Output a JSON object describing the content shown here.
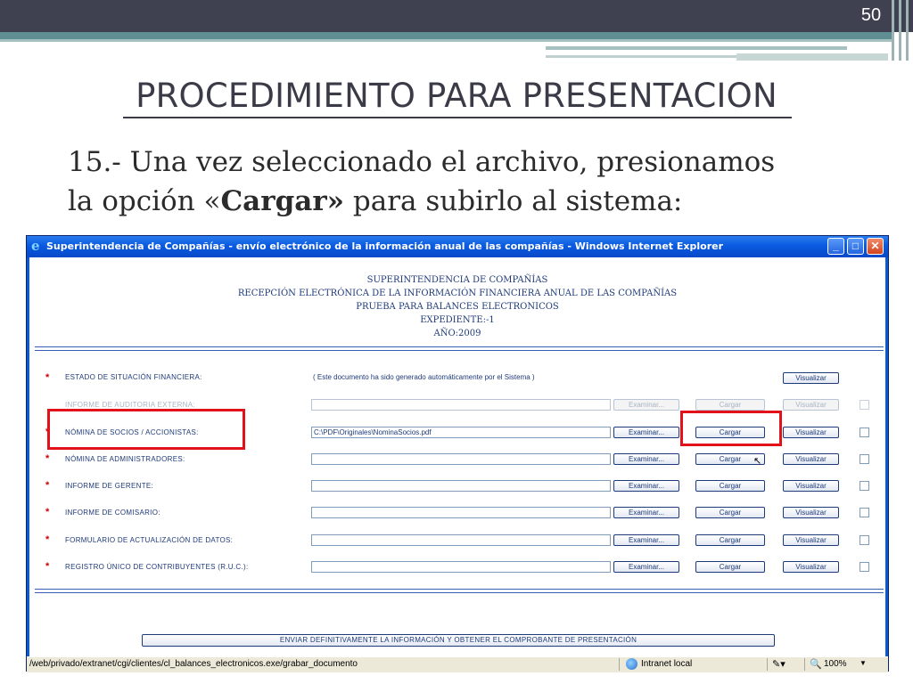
{
  "slide": {
    "page_number": "50",
    "title": "PROCEDIMIENTO PARA PRESENTACION",
    "body_line1": "15.- Una vez seleccionado el archivo, presionamos",
    "body_line2_pre": "la opción «",
    "body_line2_bold": "Cargar»",
    "body_line2_post": " para subirlo al sistema:"
  },
  "window": {
    "title": "Superintendencia de Compañías - envío electrónico de la información anual de las compañías - Windows Internet Explorer",
    "min_label": "_",
    "max_label": "□",
    "close_label": "✕"
  },
  "page_header": {
    "line1": "SUPERINTENDENCIA DE COMPAÑÍAS",
    "line2": "RECEPCIÓN ELECTRÓNICA DE LA INFORMACIÓN FINANCIERA ANUAL DE LAS COMPAÑÍAS",
    "line3": "PRUEBA PARA BALANCES ELECTRONICOS",
    "line4": "EXPEDIENTE:-1",
    "line5": "AÑO:2009"
  },
  "form": {
    "required_marker": "*",
    "rows": [
      {
        "label": "ESTADO DE SITUACIÓN FINANCIERA:",
        "note": "( Este documento ha sido generado automáticamente por el Sistema )",
        "visualizar": "Visualizar"
      },
      {
        "label": "INFORME DE AUDITORIA EXTERNA:",
        "value": "",
        "examinar": "Examinar...",
        "cargar": "Cargar",
        "visualizar": "Visualizar"
      },
      {
        "label": "NÓMINA DE SOCIOS / ACCIONISTAS:",
        "value": "C:\\PDF\\Originales\\NominaSocios.pdf",
        "examinar": "Examinar...",
        "cargar": "Cargar",
        "visualizar": "Visualizar"
      },
      {
        "label": "NÓMINA DE ADMINISTRADORES:",
        "value": "",
        "examinar": "Examinar...",
        "cargar": "Cargar",
        "visualizar": "Visualizar"
      },
      {
        "label": "INFORME DE GERENTE:",
        "value": "",
        "examinar": "Examinar...",
        "cargar": "Cargar",
        "visualizar": "Visualizar"
      },
      {
        "label": "INFORME DE COMISARIO:",
        "value": "",
        "examinar": "Examinar...",
        "cargar": "Cargar",
        "visualizar": "Visualizar"
      },
      {
        "label": "FORMULARIO DE ACTUALIZACIÓN DE DATOS:",
        "value": "",
        "examinar": "Examinar...",
        "cargar": "Cargar",
        "visualizar": "Visualizar"
      },
      {
        "label": "REGISTRO ÚNICO DE CONTRIBUYENTES (R.U.C.):",
        "value": "",
        "examinar": "Examinar...",
        "cargar": "Cargar",
        "visualizar": "Visualizar"
      }
    ],
    "submit_label": "ENVIAR DEFINITIVAMENTE LA INFORMACIÓN Y OBTENER EL COMPROBANTE DE PRESENTACIÓN"
  },
  "statusbar": {
    "url": "/web/privado/extranet/cgi/clientes/cl_balances_electronicos.exe/grabar_documento",
    "zone": "Intranet local",
    "zoom": "100%"
  },
  "colors": {
    "highlight": "#e3121a",
    "text_blue": "#1e3a7a",
    "titlebar": "#0a5ae0"
  }
}
